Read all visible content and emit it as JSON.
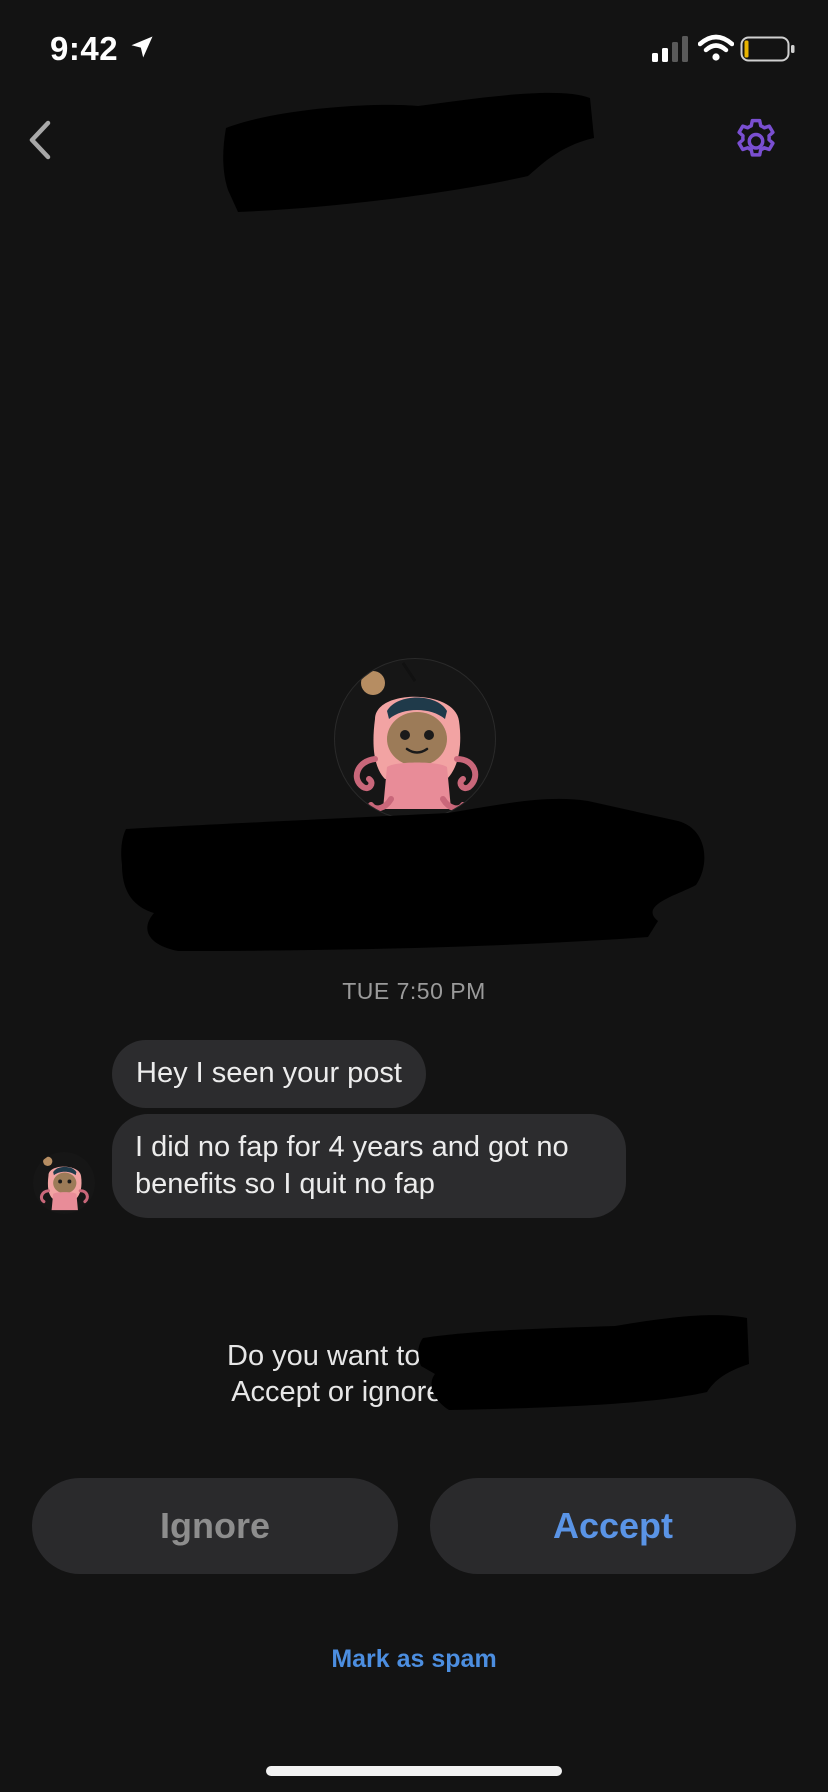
{
  "status_bar": {
    "time": "9:42"
  },
  "nav": {
    "back_icon": "chevron-left-icon",
    "settings_icon": "gear-icon",
    "accent_color": "#7a4fd1"
  },
  "conversation": {
    "timestamp": "TUE 7:50 PM",
    "messages": [
      {
        "text": "Hey I seen your post"
      },
      {
        "text": "I did no fap for 4 years and got no benefits so I quit no fap"
      }
    ]
  },
  "request": {
    "prompt_line1": "Do you want to chat with",
    "prompt_line2": "Accept or ignore the",
    "ignore_label": "Ignore",
    "accept_label": "Accept",
    "spam_label": "Mark as spam",
    "accept_color": "#5a94e6"
  }
}
